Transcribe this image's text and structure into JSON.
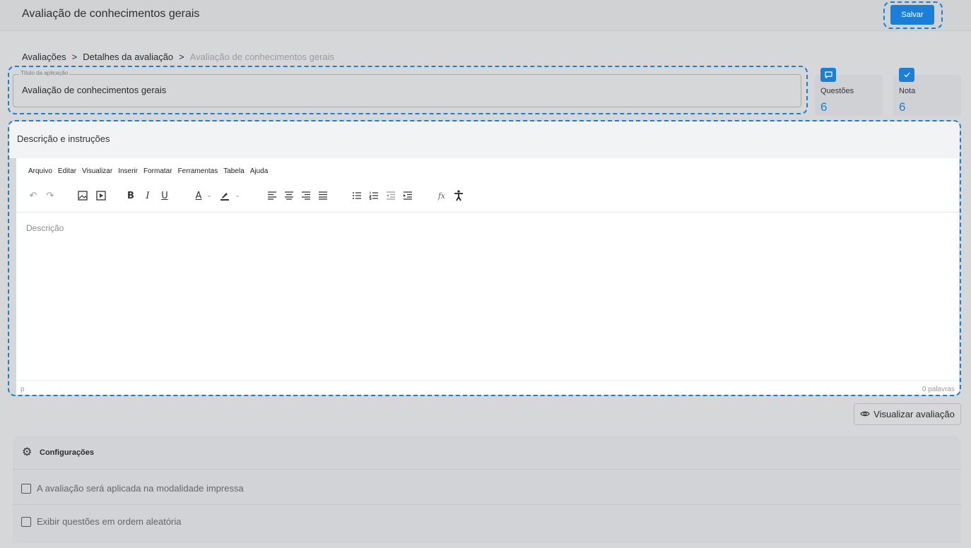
{
  "header": {
    "title": "Avaliação de conhecimentos gerais",
    "save_label": "Salvar"
  },
  "breadcrumb": {
    "items": [
      "Avaliações",
      "Detalhes da avaliação"
    ],
    "separator": ">",
    "current": "Avaliação de conhecimentos gerais"
  },
  "title_field": {
    "legend": "Título da aplicação",
    "value": "Avaliação de conhecimentos gerais"
  },
  "stats": [
    {
      "label": "Questões",
      "value": "6",
      "icon": "message-icon"
    },
    {
      "label": "Nota",
      "value": "6",
      "icon": "badge-check-icon"
    }
  ],
  "description": {
    "heading": "Descrição e instruções",
    "menu": [
      "Arquivo",
      "Editar",
      "Visualizar",
      "Inserir",
      "Formatar",
      "Ferramentas",
      "Tabela",
      "Ajuda"
    ],
    "placeholder": "Descrição",
    "status_path": "p",
    "word_count": "0 palavras"
  },
  "preview_label": "Visualizar avaliação",
  "config": {
    "title": "Configurações",
    "options": [
      {
        "label": "A avaliação será aplicada na modalidade impressa",
        "checked": false
      },
      {
        "label": "Exibir questões em ordem aleatória",
        "checked": false
      }
    ]
  },
  "colors": {
    "accent": "#1a7fd9",
    "background": "#d6d7d9"
  }
}
